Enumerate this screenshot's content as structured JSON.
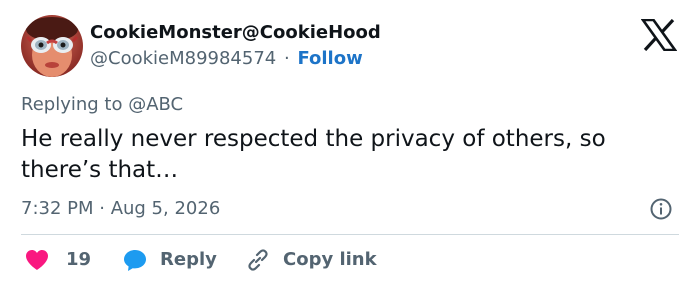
{
  "author": {
    "display_name": "CookieMonster@CookieHood",
    "handle": "@CookieM89984574",
    "separator": "·",
    "follow_label": "Follow",
    "avatar_icon": "profile-photo"
  },
  "platform": {
    "logo_icon": "x-logo-icon"
  },
  "tweet": {
    "replying_to": "Replying to @ABC",
    "text": "He really never respected the privacy of others, so there’s that…",
    "timestamp": "7:32 PM · Aug 5, 2026"
  },
  "actions": {
    "like_count": "19",
    "reply_label": "Reply",
    "copy_link_label": "Copy link"
  },
  "colors": {
    "follow_link": "#1d74c8",
    "like_heart": "#f91880",
    "reply_bubble": "#1d9bf0",
    "muted_text": "#536471",
    "divider": "#cfd9de"
  }
}
